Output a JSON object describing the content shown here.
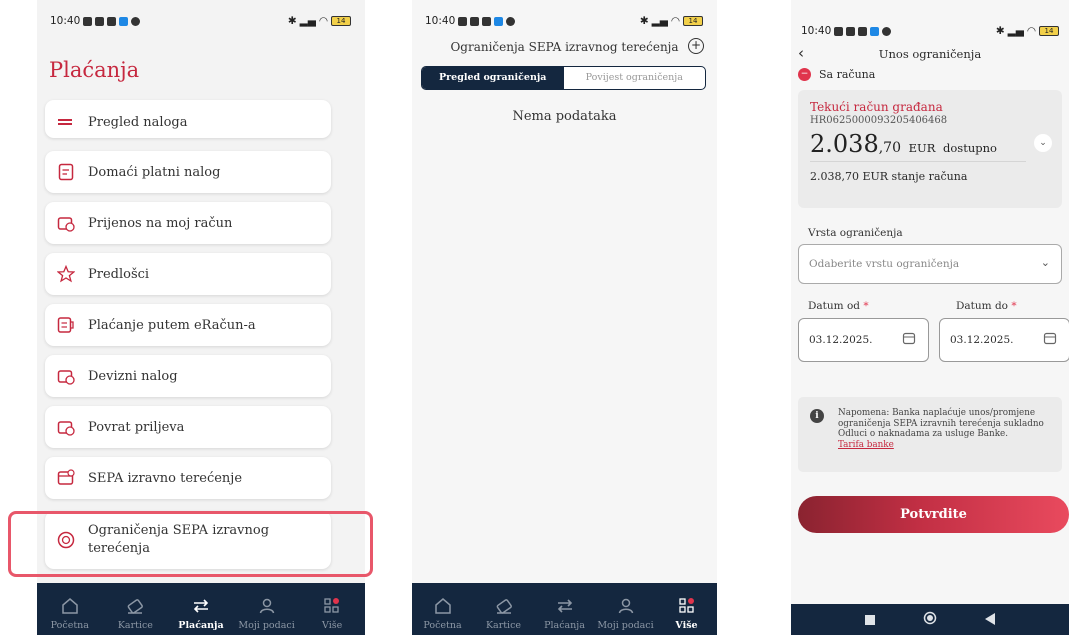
{
  "status": {
    "time": "10:40",
    "battery": "14"
  },
  "screen1": {
    "title": "Plaćanja",
    "menu": [
      {
        "label": "Pregled naloga",
        "icon": "list-icon"
      },
      {
        "label": "Domaći platni nalog",
        "icon": "document-icon"
      },
      {
        "label": "Prijenos na moj račun",
        "icon": "wallet-transfer-icon"
      },
      {
        "label": "Predlošci",
        "icon": "star-icon"
      },
      {
        "label": "Plaćanje putem eRačun-a",
        "icon": "e-invoice-icon"
      },
      {
        "label": "Devizni nalog",
        "icon": "wallet-currency-icon"
      },
      {
        "label": "Povrat priljeva",
        "icon": "wallet-return-icon"
      },
      {
        "label": "SEPA izravno terećenje",
        "icon": "sepa-debit-icon"
      },
      {
        "label": "Ograničenja SEPA izravnog terećenja",
        "icon": "sepa-limit-icon"
      }
    ],
    "nav": [
      {
        "label": "Početna",
        "icon": "home-icon",
        "active": false
      },
      {
        "label": "Kartice",
        "icon": "card-icon",
        "active": false
      },
      {
        "label": "Plaćanja",
        "icon": "transfer-icon",
        "active": true
      },
      {
        "label": "Moji podaci",
        "icon": "user-icon",
        "active": false
      },
      {
        "label": "Više",
        "icon": "grid-icon",
        "active": false
      }
    ]
  },
  "screen2": {
    "title": "Ograničenja SEPA izravnog terećenja",
    "tabs": [
      "Pregled ograničenja",
      "Povijest ograničenja"
    ],
    "empty": "Nema podataka",
    "nav": [
      {
        "label": "Početna"
      },
      {
        "label": "Kartice"
      },
      {
        "label": "Plaćanja"
      },
      {
        "label": "Moji podaci"
      },
      {
        "label": "Više"
      }
    ]
  },
  "screen3": {
    "title": "Unos ograničenja",
    "from_label": "Sa računa",
    "account": {
      "name": "Tekući račun građana",
      "iban": "HR0625000093205406468",
      "balance_int": "2.038",
      "balance_dec": ",70",
      "currency": "EUR",
      "available_label": "dostupno",
      "state": "2.038,70 EUR stanje računa"
    },
    "type_label": "Vrsta ograničenja",
    "type_placeholder": "Odaberite vrstu ograničenja",
    "date_from_label": "Datum od",
    "date_to_label": "Datum do",
    "date_from": "03.12.2025.",
    "date_to": "03.12.2025.",
    "note": "Napomena: Banka naplaćuje unos/promjene ograničenja SEPA izravnih terećenja sukladno Odluci o naknadama za usluge Banke.",
    "note_link": "Tarifa banke",
    "confirm": "Potvrdite"
  },
  "colors": {
    "brand_red": "#c6283f",
    "navy": "#14273f"
  }
}
